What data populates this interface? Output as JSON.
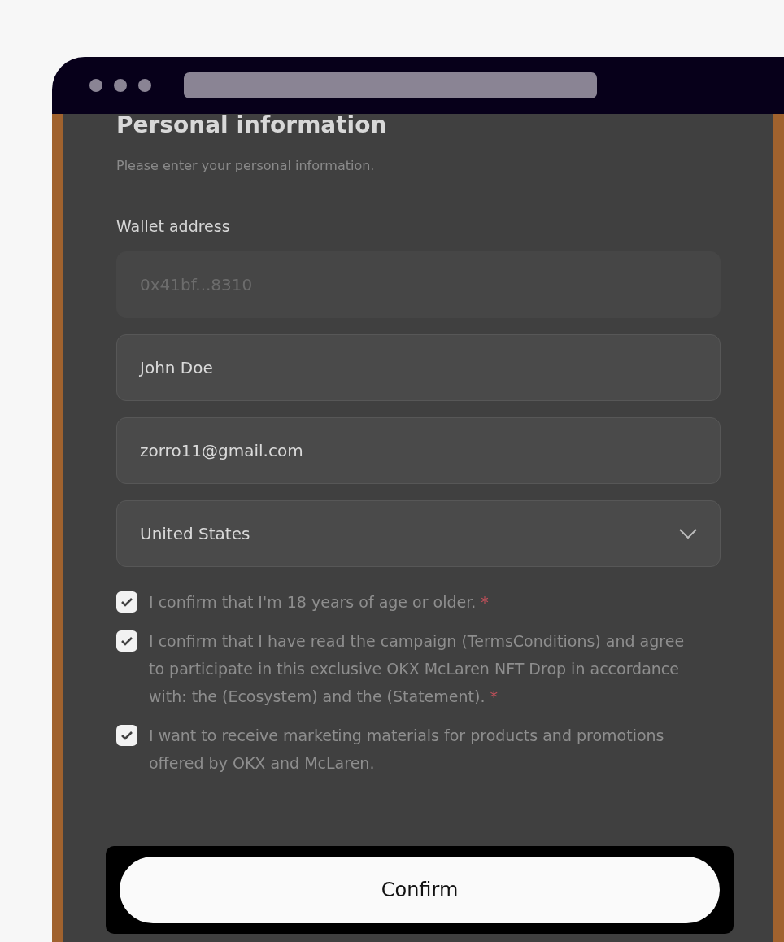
{
  "form": {
    "title": "Personal information",
    "subtitle": "Please enter your personal information.",
    "wallet_label": "Wallet address",
    "fields": [
      {
        "kind": "text",
        "value": "0x41bf...8310",
        "disabled": true
      },
      {
        "kind": "text",
        "value": "John Doe",
        "disabled": false
      },
      {
        "kind": "text",
        "value": "zorro11@gmail.com",
        "disabled": false
      },
      {
        "kind": "select",
        "value": "United States",
        "disabled": false
      }
    ],
    "agreements": [
      {
        "text": "I confirm that I'm 18 years of age or older.",
        "required_mark": "*",
        "checked": true
      },
      {
        "text": "I confirm that I have read the campaign (TermsConditions) and agree to participate in this exclusive OKX McLaren NFT Drop in accordance with: the (Ecosystem) and the (Statement).",
        "required_mark": "*",
        "checked": true
      },
      {
        "text": "I want to receive marketing materials for products and promotions offered by OKX and McLaren.",
        "checked": true
      }
    ],
    "confirm_button": "Confirm"
  }
}
